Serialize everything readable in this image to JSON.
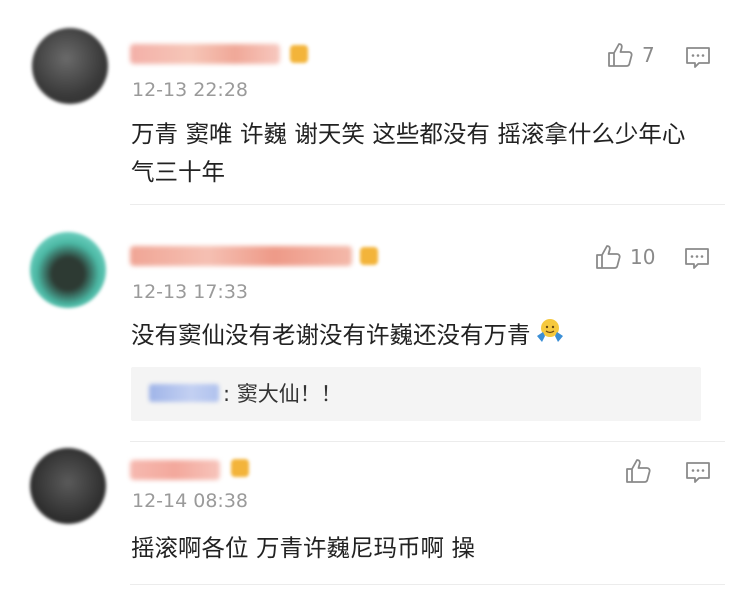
{
  "comments": [
    {
      "time": "12-13 22:28",
      "text": "万青 窦唯 许巍 谢天笑 这些都没有 摇滚拿什么少年心气三十年",
      "likes": "7"
    },
    {
      "time": "12-13 17:33",
      "text": "没有窦仙没有老谢没有许巍还没有万青",
      "likes": "10",
      "reply": {
        "text": ": 窦大仙！！"
      }
    },
    {
      "time": "12-14 08:38",
      "text": "摇滚啊各位 万青许巍尼玛币啊 操",
      "likes": ""
    }
  ],
  "icons": {
    "like": "thumbs-up-icon",
    "reply": "comment-icon",
    "emoji": "shrug-emoji"
  },
  "colors": {
    "text": "#222222",
    "meta": "#9a9a9a",
    "quote_bg": "#f4f4f4"
  }
}
